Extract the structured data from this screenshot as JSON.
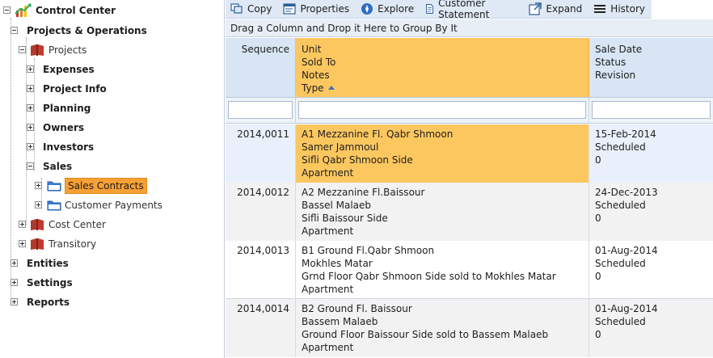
{
  "tree": {
    "root": "Control Center",
    "projects_ops": "Projects & Operations",
    "projects": "Projects",
    "expenses": "Expenses",
    "project_info": "Project Info",
    "planning": "Planning",
    "owners": "Owners",
    "investors": "Investors",
    "sales": "Sales",
    "sales_contracts": "Sales Contracts",
    "customer_payments": "Customer Payments",
    "cost_center": "Cost Center",
    "transitory": "Transitory",
    "entities": "Entities",
    "settings": "Settings",
    "reports": "Reports"
  },
  "toolbar": {
    "copy": "Copy",
    "properties": "Properties",
    "explore": "Explore",
    "customer_statement": "Customer Statement",
    "expand": "Expand",
    "history": "History"
  },
  "group_panel": "Drag a Column and Drop it Here to Group By It",
  "columns": {
    "c1": [
      "Sequence"
    ],
    "c2": [
      "Unit",
      "Sold To",
      "Notes",
      "Type"
    ],
    "c3": [
      "Sale Date",
      "Status",
      "Revision"
    ]
  },
  "rows": [
    {
      "seq": "2014,0011",
      "unit": "A1 Mezzanine Fl. Qabr Shmoon",
      "sold_to": "Samer Jammoul",
      "notes": "Sifli Qabr Shmoon Side",
      "type": "Apartment",
      "date": "15-Feb-2014",
      "status": "Scheduled",
      "revision": "0"
    },
    {
      "seq": "2014,0012",
      "unit": "A2 Mezzanine Fl.Baissour",
      "sold_to": "Bassel Malaeb",
      "notes": "Sifli Baissour Side",
      "type": "Apartment",
      "date": "24-Dec-2013",
      "status": "Scheduled",
      "revision": "0"
    },
    {
      "seq": "2014,0013",
      "unit": "B1 Ground Fl.Qabr Shmoon",
      "sold_to": "Mokhles Matar",
      "notes": "Grnd Floor Qabr Shmoon Side sold to Mokhles Matar",
      "type": "Apartment",
      "date": "01-Aug-2014",
      "status": "Scheduled",
      "revision": "0"
    },
    {
      "seq": "2014,0014",
      "unit": "B2 Ground Fl. Baissour",
      "sold_to": "Bassem Malaeb",
      "notes": "Ground Floor Baissour Side sold to Bassem Malaeb",
      "type": "Apartment",
      "date": "01-Aug-2014",
      "status": "Scheduled",
      "revision": "0"
    }
  ],
  "colors": {
    "accent": "#fdc760",
    "selected_tree": "#f7a034",
    "header": "#d7e5f4",
    "toolbar": "#dfe9f5"
  }
}
